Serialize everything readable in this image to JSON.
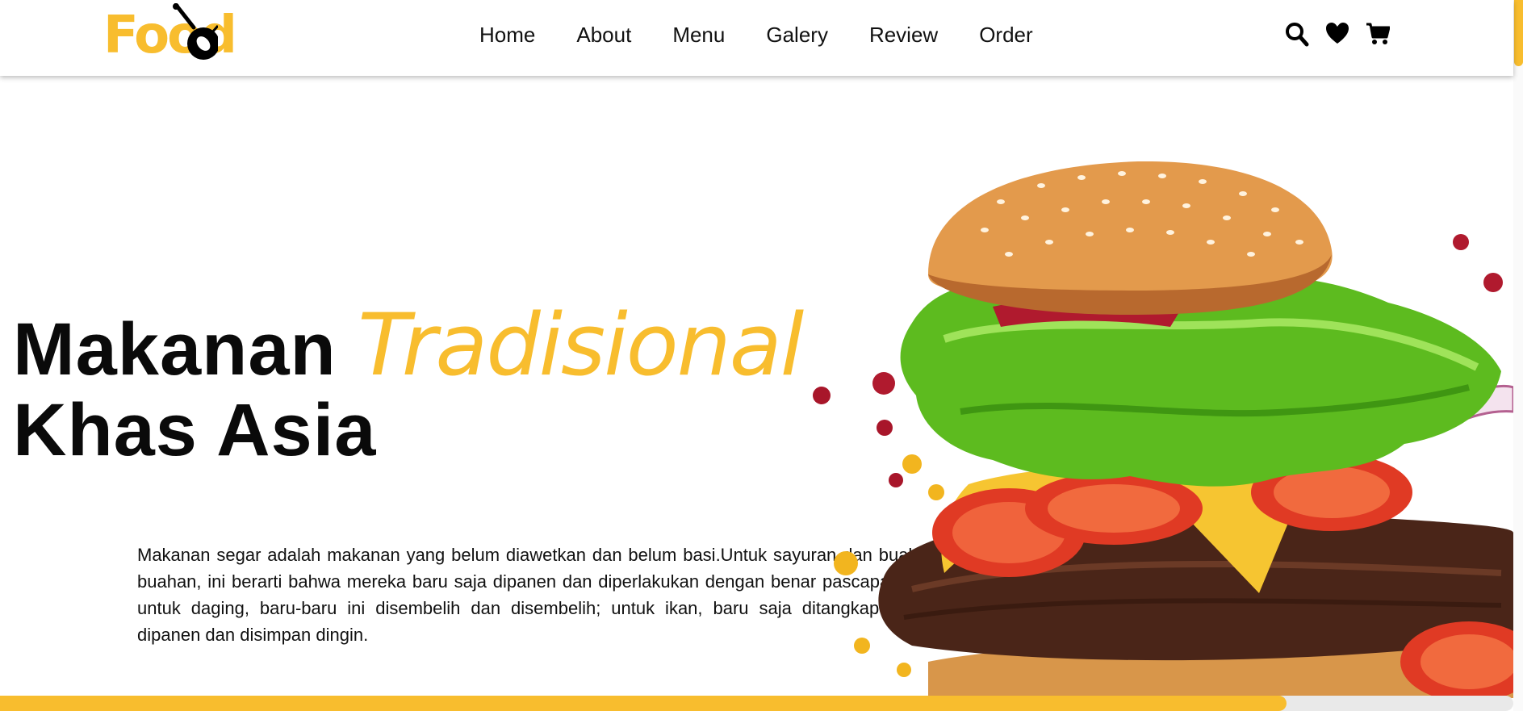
{
  "brand": {
    "logo_text": "Food"
  },
  "nav": {
    "items": [
      {
        "label": "Home"
      },
      {
        "label": "About"
      },
      {
        "label": "Menu"
      },
      {
        "label": "Galery"
      },
      {
        "label": "Review"
      },
      {
        "label": "Order"
      }
    ],
    "icons": [
      "search-icon",
      "heart-icon",
      "cart-icon"
    ]
  },
  "hero": {
    "title_part1": "Makanan ",
    "title_accent": "Tradisional",
    "title_part2": "Khas Asia",
    "description": "Makanan segar adalah makanan yang belum diawetkan dan belum basi.Untuk sayuran dan buah-buahan, ini berarti bahwa mereka baru saja dipanen dan diperlakukan dengan benar pascapanen; untuk daging, baru-baru ini disembelih dan disembelih; untuk ikan, baru saja ditangkap atau dipanen dan disimpan dingin."
  },
  "progress": {
    "fraction": 0.85
  },
  "colors": {
    "accent": "#f8bd2e",
    "text": "#0a0a0a",
    "background": "#ffffff"
  }
}
